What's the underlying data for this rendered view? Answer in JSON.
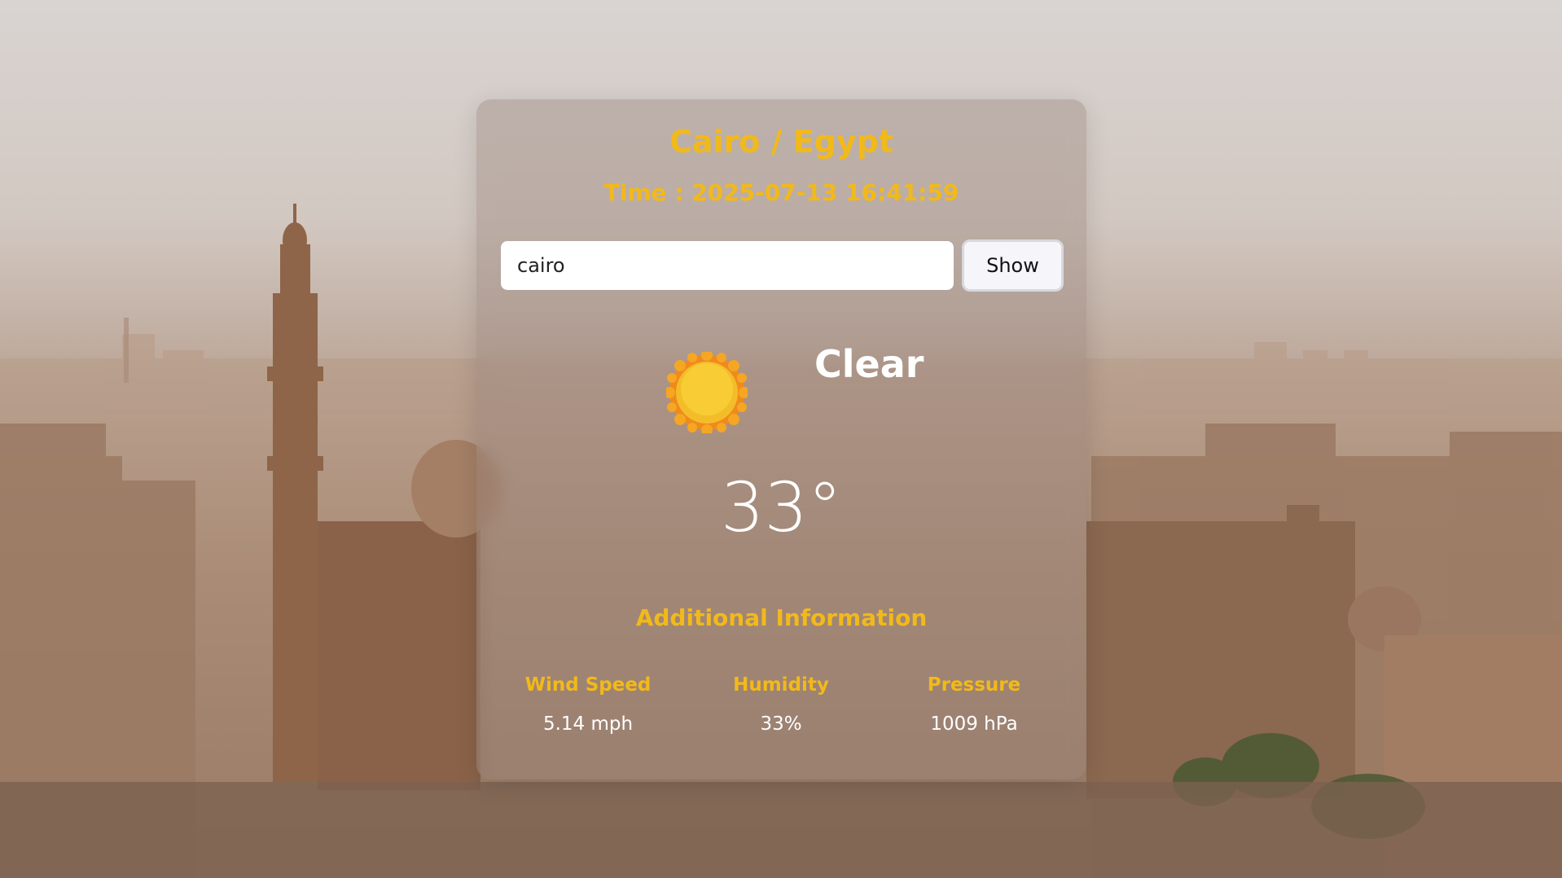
{
  "location": {
    "title": "Cairo / Egypt",
    "time": "Time : 2025-07-13 16:41:59"
  },
  "search": {
    "value": "cairo",
    "button_label": "Show"
  },
  "weather": {
    "icon": "sun-icon",
    "condition": "Clear",
    "temperature": "33°"
  },
  "additional": {
    "heading": "Additional Information",
    "stats": [
      {
        "label": "Wind Speed",
        "value": "5.14 mph"
      },
      {
        "label": "Humidity",
        "value": "33%"
      },
      {
        "label": "Pressure",
        "value": "1009 hPa"
      }
    ]
  },
  "colors": {
    "accent": "#f2b91a",
    "text_light": "#ffffff"
  }
}
